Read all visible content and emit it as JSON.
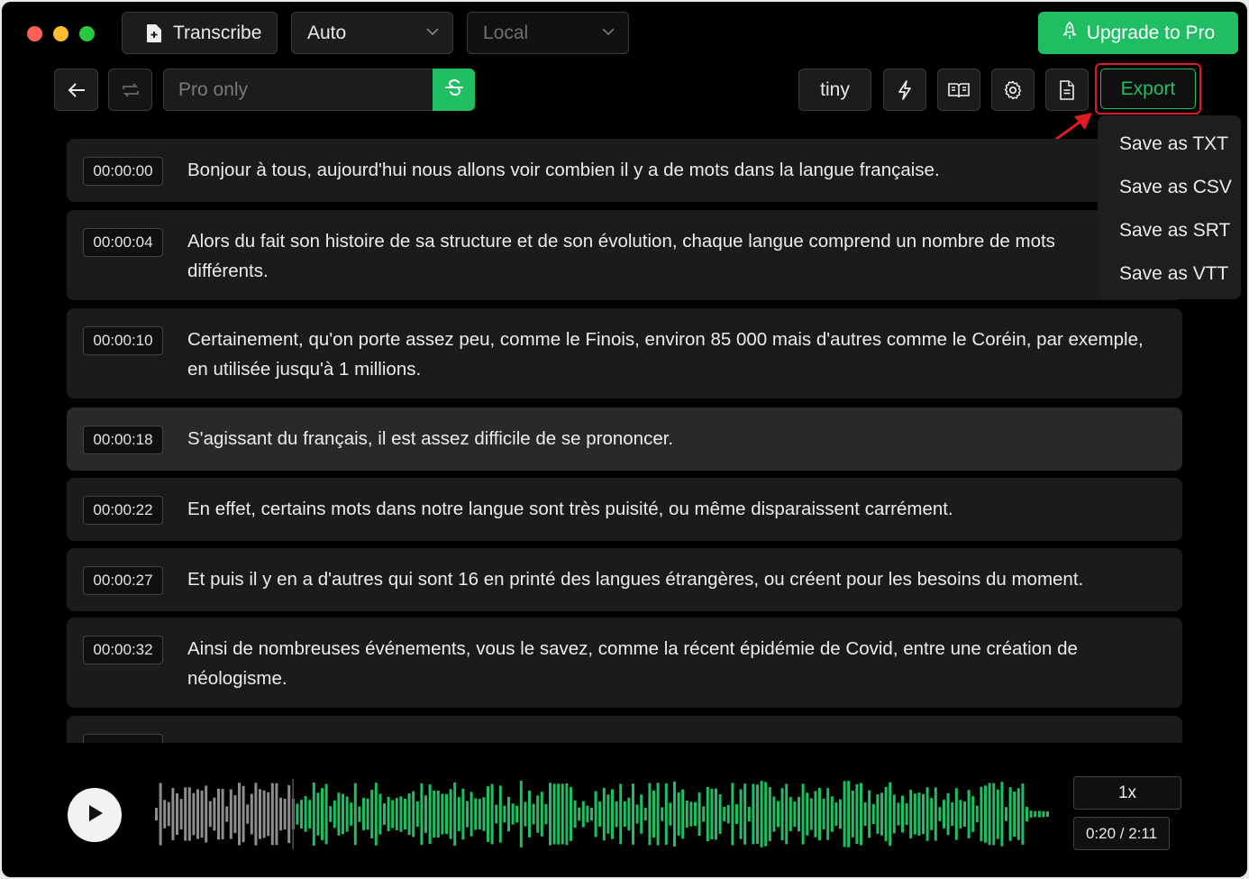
{
  "window": {
    "traffic_lights": [
      "close",
      "minimize",
      "maximize"
    ]
  },
  "toolbar": {
    "transcribe_label": "Transcribe",
    "language_value": "Auto",
    "engine_value": "Local",
    "upgrade_label": "Upgrade to Pro"
  },
  "secondary": {
    "search_placeholder": "Pro only",
    "model_label": "tiny",
    "export_label": "Export"
  },
  "export_menu": {
    "items": [
      {
        "label": "Save as TXT"
      },
      {
        "label": "Save as CSV"
      },
      {
        "label": "Save as SRT"
      },
      {
        "label": "Save as VTT"
      }
    ]
  },
  "segments": [
    {
      "time": "00:00:00",
      "text": "Bonjour à tous, aujourd'hui nous allons voir combien il y a de mots dans la langue française."
    },
    {
      "time": "00:00:04",
      "text": "Alors du fait son histoire de sa structure et de son évolution, chaque langue comprend un nombre de mots différents."
    },
    {
      "time": "00:00:10",
      "text": "Certainement, qu'on porte assez peu, comme le Finois, environ 85 000 mais d'autres comme le Coréin, par exemple, en utilisée jusqu'à 1 millions."
    },
    {
      "time": "00:00:18",
      "text": "S'agissant du français, il est assez difficile de se prononcer."
    },
    {
      "time": "00:00:22",
      "text": "En effet, certains mots dans notre langue sont très puisité, ou même disparaissent carrément."
    },
    {
      "time": "00:00:27",
      "text": "Et puis il y en a d'autres qui sont 16 en printé des langues étrangères, ou créent pour les besoins du moment."
    },
    {
      "time": "00:00:32",
      "text": "Ainsi de nombreuses événements, vous le savez, comme la récent épidémie de Covid, entre une création de néologisme."
    }
  ],
  "player": {
    "speed_label": "1x",
    "time_label": "0:20 / 2:11",
    "progress": 0.153
  },
  "colors": {
    "accent": "#1fbe63",
    "played_wave": "#8e8e8e",
    "highlight": "#e01b24",
    "close": "#fe5f57",
    "minimize": "#febc2e",
    "maximize": "#28c840"
  }
}
